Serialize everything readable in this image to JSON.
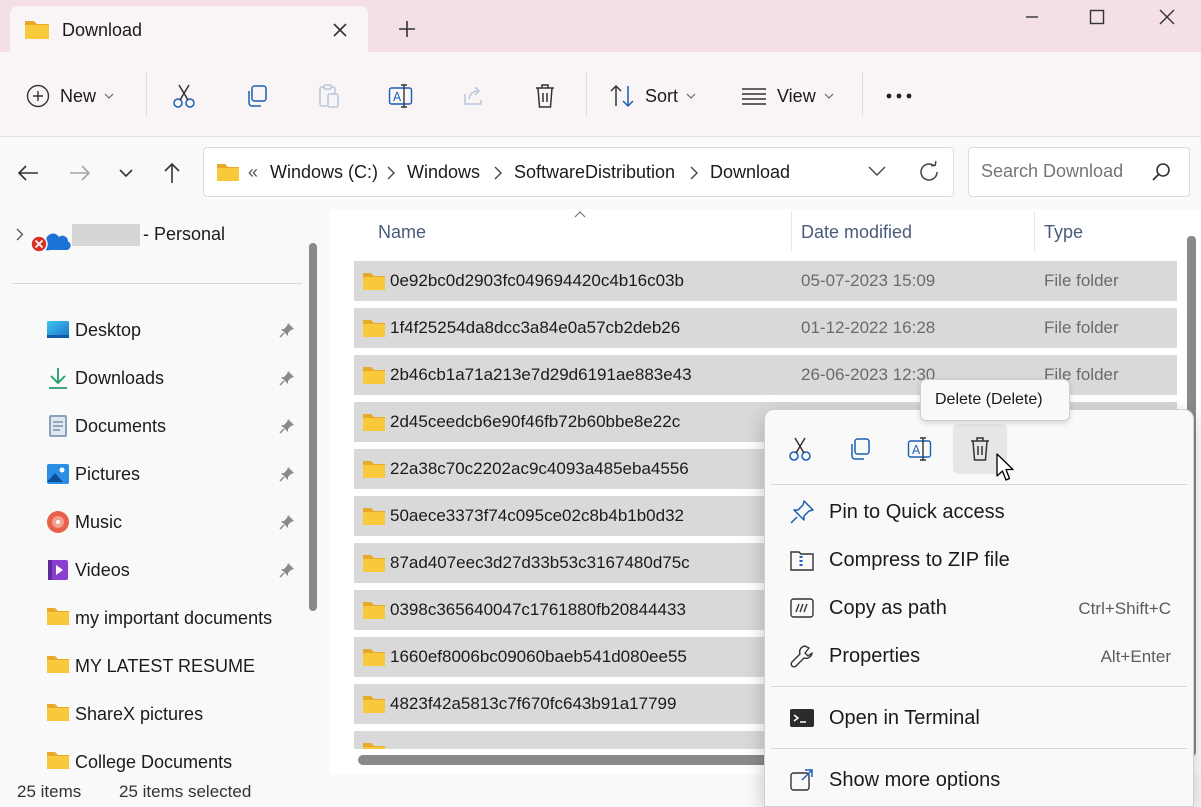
{
  "tab": {
    "title": "Download"
  },
  "toolbar": {
    "new_label": "New",
    "sort_label": "Sort",
    "view_label": "View"
  },
  "address": {
    "overflow": "«",
    "segments": [
      "Windows (C:)",
      "Windows",
      "SoftwareDistribution",
      "Download"
    ]
  },
  "search": {
    "placeholder": "Search Download"
  },
  "nav": {
    "onedrive_label": "- Personal",
    "items": [
      {
        "label": "Desktop",
        "icon": "desktop-icon",
        "pinned": true
      },
      {
        "label": "Downloads",
        "icon": "download-arrow-icon",
        "pinned": true
      },
      {
        "label": "Documents",
        "icon": "document-icon",
        "pinned": true
      },
      {
        "label": "Pictures",
        "icon": "picture-icon",
        "pinned": true
      },
      {
        "label": "Music",
        "icon": "music-icon",
        "pinned": true
      },
      {
        "label": "Videos",
        "icon": "video-icon",
        "pinned": true
      },
      {
        "label": "my important documents",
        "icon": "folder-icon",
        "pinned": false
      },
      {
        "label": "MY LATEST RESUME",
        "icon": "folder-icon",
        "pinned": false
      },
      {
        "label": "ShareX pictures",
        "icon": "folder-icon",
        "pinned": false
      },
      {
        "label": "College Documents",
        "icon": "folder-icon",
        "pinned": false
      }
    ]
  },
  "columns": {
    "name": "Name",
    "date": "Date modified",
    "type": "Type"
  },
  "files": [
    {
      "name": "0e92bc0d2903fc049694420c4b16c03b",
      "date": "05-07-2023 15:09",
      "type": "File folder"
    },
    {
      "name": "1f4f25254da8dcc3a84e0a57cb2deb26",
      "date": "01-12-2022 16:28",
      "type": "File folder"
    },
    {
      "name": "2b46cb1a71a213e7d29d6191ae883e43",
      "date": "26-06-2023 12:30",
      "type": "File folder"
    },
    {
      "name": "2d45ceedcb6e90f46fb72b60bbe8e22c",
      "date": "",
      "type": ""
    },
    {
      "name": "22a38c70c2202ac9c4093a485eba4556",
      "date": "",
      "type": ""
    },
    {
      "name": "50aece3373f74c095ce02c8b4b1b0d32",
      "date": "",
      "type": ""
    },
    {
      "name": "87ad407eec3d27d33b53c3167480d75c",
      "date": "",
      "type": ""
    },
    {
      "name": "0398c365640047c1761880fb20844433",
      "date": "",
      "type": ""
    },
    {
      "name": "1660ef8006bc09060baeb541d080ee55",
      "date": "",
      "type": ""
    },
    {
      "name": "4823f42a5813c7f670fc643b91a17799",
      "date": "",
      "type": ""
    }
  ],
  "status": {
    "items": "25 items",
    "selected": "25 items selected"
  },
  "tooltip": {
    "text": "Delete (Delete)"
  },
  "context_menu": {
    "items": [
      {
        "label": "Pin to Quick access",
        "shortcut": "",
        "icon": "pin-icon"
      },
      {
        "label": "Compress to ZIP file",
        "shortcut": "",
        "icon": "zip-icon"
      },
      {
        "label": "Copy as path",
        "shortcut": "Ctrl+Shift+C",
        "icon": "copy-path-icon"
      },
      {
        "label": "Properties",
        "shortcut": "Alt+Enter",
        "icon": "wrench-icon"
      },
      {
        "label": "Open in Terminal",
        "shortcut": "",
        "icon": "terminal-icon"
      },
      {
        "label": "Show more options",
        "shortcut": "",
        "icon": "share-icon"
      }
    ]
  },
  "colors": {
    "accent": "#0067c0",
    "folder": "#f8c93a",
    "selection": "#d9d9d9",
    "tab_strip": "#f3dfe5"
  }
}
